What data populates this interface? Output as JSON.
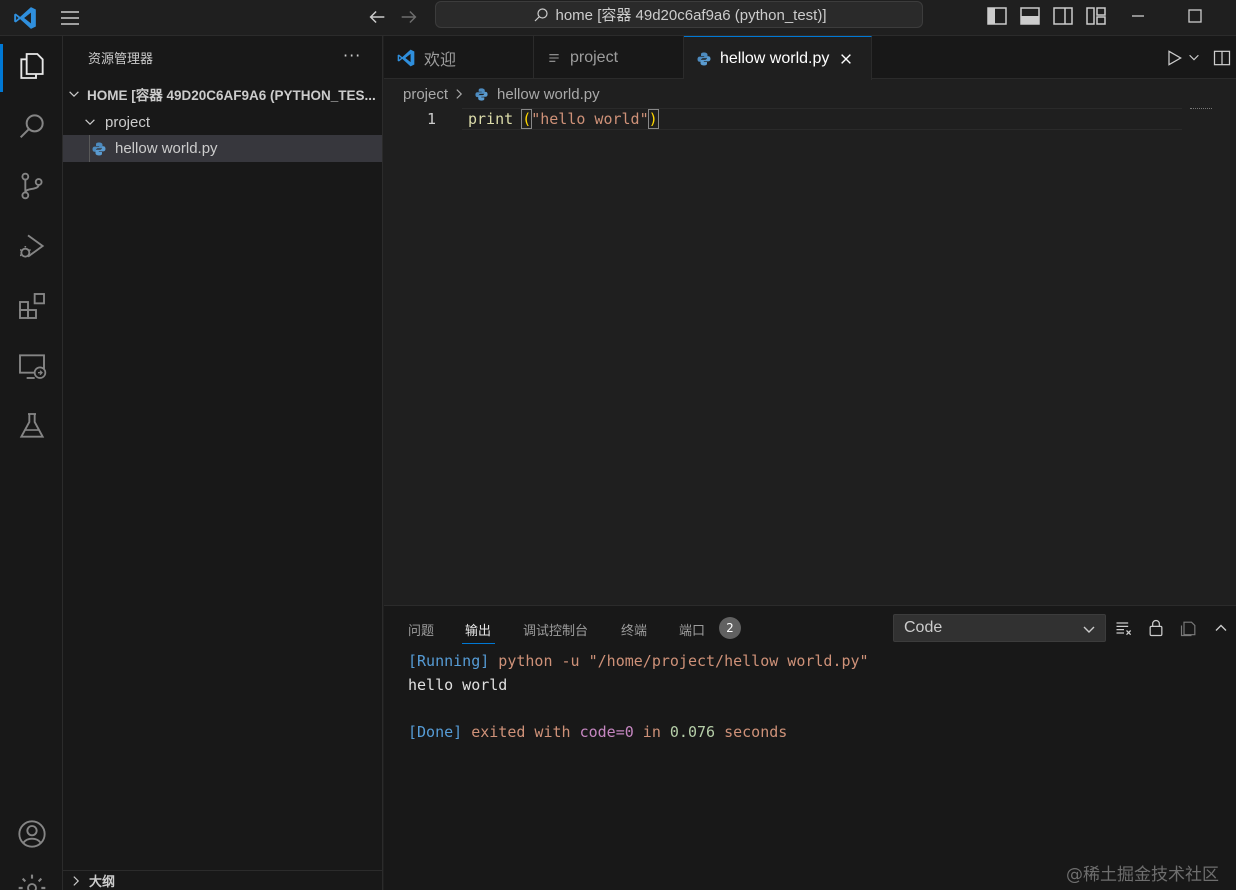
{
  "titlebar": {
    "search_text": "home [容器 49d20c6af9a6 (python_test)]"
  },
  "sidebar": {
    "title": "资源管理器",
    "more": "···",
    "root_label": "HOME [容器 49D20C6AF9A6 (PYTHON_TES...",
    "folder_label": "project",
    "file_label": "hellow world.py",
    "outline_label": "大纲"
  },
  "tabs": [
    {
      "label": "欢迎",
      "icon": "vscode-icon"
    },
    {
      "label": "project",
      "icon": "list-icon"
    },
    {
      "label": "hellow world.py",
      "icon": "python-icon",
      "active": true
    }
  ],
  "breadcrumb": {
    "folder": "project",
    "file": "hellow world.py"
  },
  "editor": {
    "line_number": "1",
    "code_fn": "print",
    "code_space": " ",
    "code_open": "(",
    "code_str": "\"hello world\"",
    "code_close": ")"
  },
  "panel": {
    "tabs": [
      "问题",
      "输出",
      "调试控制台",
      "终端",
      "端口"
    ],
    "ports_badge": "2",
    "channel_select": "Code",
    "output": {
      "line1_tag": "[Running]",
      "line1_cmd": " python -u \"/home/project/hellow world.py\"",
      "line2": "hello world",
      "line4_tag": "[Done]",
      "line4_a": " exited with ",
      "line4_code": "code=0",
      "line4_in": " in ",
      "line4_num": "0.076",
      "line4_sec": " seconds"
    }
  },
  "watermark": "@稀土掘金技术社区",
  "colors": {
    "accent": "#0078d4",
    "background": "#1f1f1f",
    "sidebar": "#181818"
  }
}
